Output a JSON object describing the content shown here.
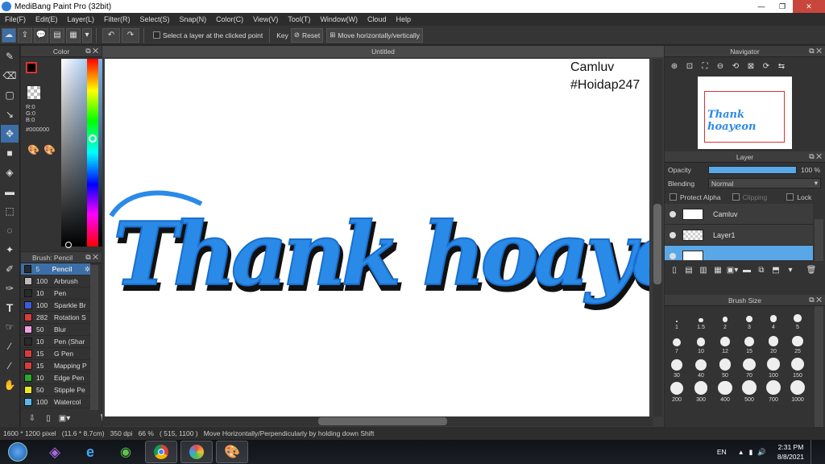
{
  "window": {
    "title": "MediBang Paint Pro (32bit)",
    "controls": {
      "minimize": "—",
      "maximize": "❐",
      "close": "✕"
    }
  },
  "menu": [
    "File(F)",
    "Edit(E)",
    "Layer(L)",
    "Filter(R)",
    "Select(S)",
    "Snap(N)",
    "Color(C)",
    "View(V)",
    "Tool(T)",
    "Window(W)",
    "Cloud",
    "Help"
  ],
  "toolbar": {
    "select_layer_label": "Select a layer at the clicked point",
    "key_label": "Key",
    "reset_label": "Reset",
    "move_label": "Move horizontally/vertically"
  },
  "color_panel": {
    "title": "Color",
    "r": "R:0",
    "g": "G:0",
    "b": "B:0",
    "hex": "#000000"
  },
  "brush_panel": {
    "title": "Brush: Pencil",
    "items": [
      {
        "size": "5",
        "name": "Pencil",
        "color": "#2a2a2a"
      },
      {
        "size": "100",
        "name": "Arbrush",
        "color": "#bbbbbb"
      },
      {
        "size": "10",
        "name": "Pen",
        "color": "#2a2a2a"
      },
      {
        "size": "100",
        "name": "Sparkle Br",
        "color": "#3c5bd8"
      },
      {
        "size": "282",
        "name": "Rotation S",
        "color": "#d83c3c"
      },
      {
        "size": "50",
        "name": "Blur",
        "color": "#f0a0e0"
      },
      {
        "size": "10",
        "name": "Pen (Shar",
        "color": "#2a2a2a"
      },
      {
        "size": "15",
        "name": "G Pen",
        "color": "#d83c3c"
      },
      {
        "size": "15",
        "name": "Mapping P",
        "color": "#d83c3c"
      },
      {
        "size": "10",
        "name": "Edge Pen",
        "color": "#2aa82a"
      },
      {
        "size": "50",
        "name": "Stipple Pe",
        "color": "#e8e82a"
      },
      {
        "size": "100",
        "name": "Watercol",
        "color": "#5ab8f0"
      }
    ]
  },
  "canvas": {
    "tab_title": "Untitled",
    "artwork_text": "Thank hoayeon",
    "note_line1": "Camluv",
    "note_line2": "#Hoidap247"
  },
  "navigator": {
    "title": "Navigator"
  },
  "layer_panel": {
    "title": "Layer",
    "opacity_label": "Opacity",
    "opacity_value": "100 %",
    "opacity": 1.0,
    "blending_label": "Blending",
    "blending_value": "Normal",
    "protect_alpha": "Protect Alpha",
    "clipping": "Clipping",
    "lock": "Lock",
    "layers": [
      {
        "name": "Camluv",
        "selected": false
      },
      {
        "name": "Layer1",
        "selected": false
      },
      {
        "name": "",
        "selected": true
      }
    ]
  },
  "brush_size": {
    "title": "Brush Size",
    "sizes": [
      "1",
      "1.5",
      "2",
      "3",
      "4",
      "5",
      "7",
      "10",
      "12",
      "15",
      "20",
      "25",
      "30",
      "40",
      "50",
      "70",
      "100",
      "150",
      "200",
      "300",
      "400",
      "500",
      "700",
      "1000"
    ]
  },
  "status": {
    "text": "1600 * 1200 pixel   (11.6 * 8.7cm)   350 dpi   66 %   ( 515, 1100 )   Move Horizontally/Perpendicularly by holding down Shift"
  },
  "taskbar": {
    "lang": "EN",
    "time": "2:31 PM",
    "date": "8/8/2021"
  },
  "colors": {
    "accent": "#3c6fa8",
    "stroke": "#2a8ae8"
  }
}
